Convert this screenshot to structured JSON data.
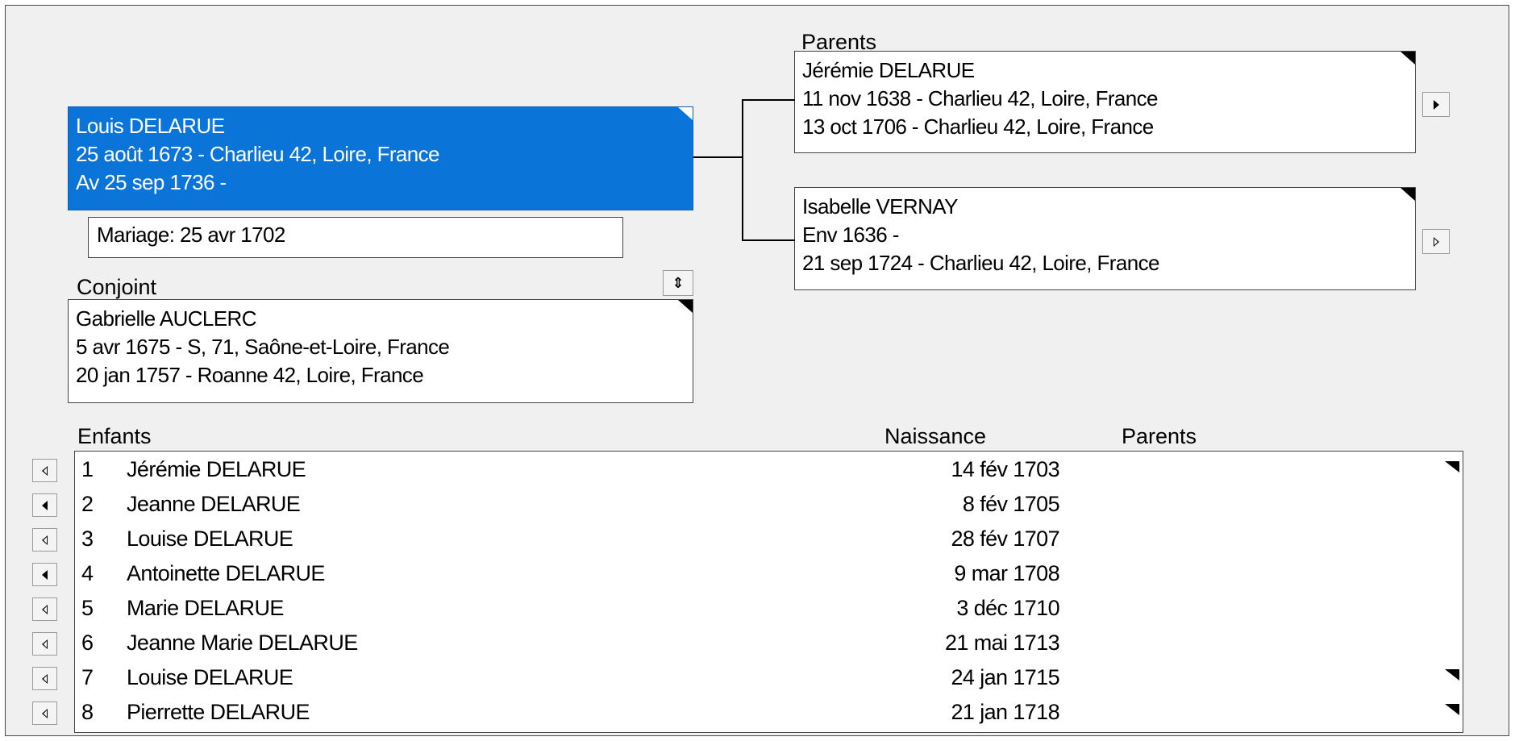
{
  "focus_person": {
    "name": "Louis DELARUE",
    "birth": "25 août 1673 - Charlieu 42, Loire, France",
    "death": "Av 25 sep 1736 -"
  },
  "marriage": {
    "text": "Mariage: 25 avr 1702"
  },
  "spouse": {
    "heading": "Conjoint",
    "name": "Gabrielle AUCLERC",
    "birth": "5 avr 1675 - S, 71, Saône-et-Loire, France",
    "death": "20 jan 1757 - Roanne 42, Loire, France"
  },
  "parents": {
    "heading": "Parents",
    "father": {
      "name": "Jérémie DELARUE",
      "birth": "11 nov 1638 - Charlieu 42, Loire, France",
      "death": "13 oct 1706 - Charlieu 42, Loire, France"
    },
    "mother": {
      "name": "Isabelle VERNAY",
      "birth": "Env 1636 -",
      "death": "21 sep 1724 - Charlieu 42, Loire, France"
    }
  },
  "children": {
    "headers": {
      "children": "Enfants",
      "birth": "Naissance",
      "parents": "Parents"
    },
    "rows": [
      {
        "num": "1",
        "name": "Jérémie DELARUE",
        "birth": "14 fév 1703",
        "has_children": true,
        "navigable": false
      },
      {
        "num": "2",
        "name": "Jeanne DELARUE",
        "birth": "8 fév 1705",
        "has_children": false,
        "navigable": true
      },
      {
        "num": "3",
        "name": "Louise DELARUE",
        "birth": "28 fév 1707",
        "has_children": false,
        "navigable": false
      },
      {
        "num": "4",
        "name": "Antoinette DELARUE",
        "birth": "9 mar 1708",
        "has_children": false,
        "navigable": true
      },
      {
        "num": "5",
        "name": "Marie DELARUE",
        "birth": "3 déc 1710",
        "has_children": false,
        "navigable": false
      },
      {
        "num": "6",
        "name": "Jeanne Marie DELARUE",
        "birth": "21 mai 1713",
        "has_children": false,
        "navigable": false
      },
      {
        "num": "7",
        "name": "Louise DELARUE",
        "birth": "24 jan 1715",
        "has_children": true,
        "navigable": false
      },
      {
        "num": "8",
        "name": "Pierrette DELARUE",
        "birth": "21 jan 1718",
        "has_children": true,
        "navigable": false
      }
    ]
  },
  "colors": {
    "selected_bg": "#0a74d9",
    "panel_bg": "#f0f0f0"
  },
  "icons": {
    "father_nav": "arrow-right-icon",
    "mother_nav": "arrow-right-outline-icon",
    "spouse_switch": "up-down-arrows-icon",
    "child_nav": "arrow-left-icon"
  }
}
